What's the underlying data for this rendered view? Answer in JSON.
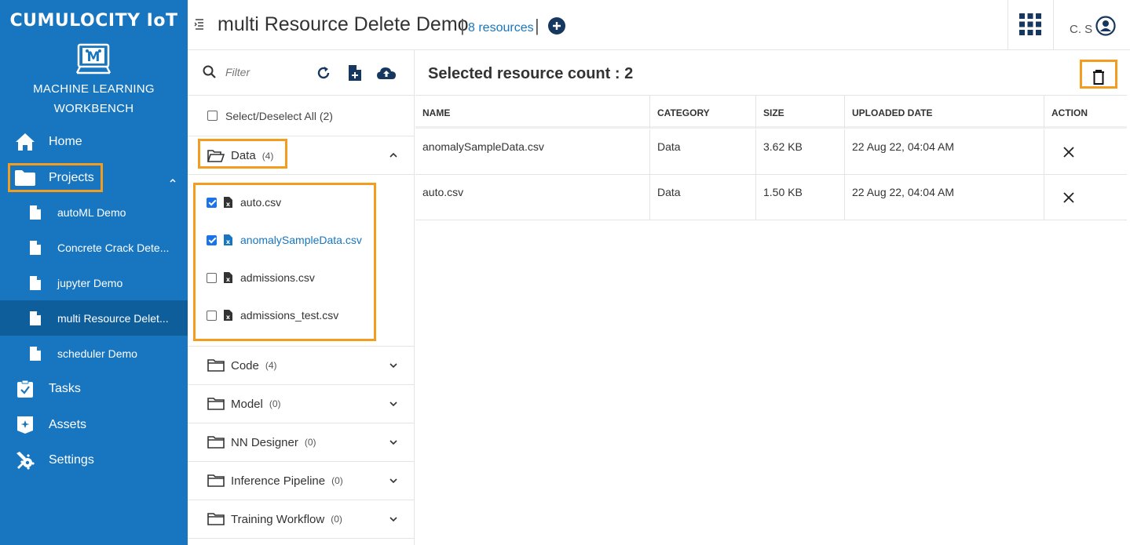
{
  "brand": "CUMULOCITY IoT",
  "app": {
    "name_line1": "MACHINE LEARNING",
    "name_line2": "WORKBENCH"
  },
  "nav": {
    "home": "Home",
    "projects": "Projects",
    "tasks": "Tasks",
    "assets": "Assets",
    "settings": "Settings",
    "project_items": [
      "autoML Demo",
      "Concrete Crack Dete...",
      "jupyter Demo",
      "multi Resource Delet...",
      "scheduler Demo"
    ]
  },
  "header": {
    "title": "multi Resource Delete Demo",
    "resources": "8 resources",
    "user": "C. S"
  },
  "filter": {
    "placeholder": "Filter"
  },
  "select_all": "Select/Deselect All (2)",
  "folders": {
    "data": {
      "label": "Data",
      "count": "(4)"
    },
    "code": {
      "label": "Code",
      "count": "(4)"
    },
    "model": {
      "label": "Model",
      "count": "(0)"
    },
    "nn": {
      "label": "NN Designer",
      "count": "(0)"
    },
    "inference": {
      "label": "Inference Pipeline",
      "count": "(0)"
    },
    "training": {
      "label": "Training Workflow",
      "count": "(0)"
    }
  },
  "files": [
    {
      "name": "auto.csv",
      "checked": true
    },
    {
      "name": "anomalySampleData.csv",
      "checked": true
    },
    {
      "name": "admissions.csv",
      "checked": false
    },
    {
      "name": "admissions_test.csv",
      "checked": false
    }
  ],
  "selected_title": "Selected resource count : 2",
  "table": {
    "headers": {
      "name": "NAME",
      "category": "CATEGORY",
      "size": "SIZE",
      "date": "UPLOADED DATE",
      "action": "ACTION"
    },
    "rows": [
      {
        "name": "anomalySampleData.csv",
        "category": "Data",
        "size": "3.62 KB",
        "date": "22 Aug 22, 04:04 AM"
      },
      {
        "name": "auto.csv",
        "category": "Data",
        "size": "1.50 KB",
        "date": "22 Aug 22, 04:04 AM"
      }
    ]
  },
  "colors": {
    "sidebar": "#1776bf",
    "sidebar_active": "#0f5e9c",
    "highlight": "#f39c1e",
    "header_icon": "#16375f",
    "link": "#1776bf"
  }
}
